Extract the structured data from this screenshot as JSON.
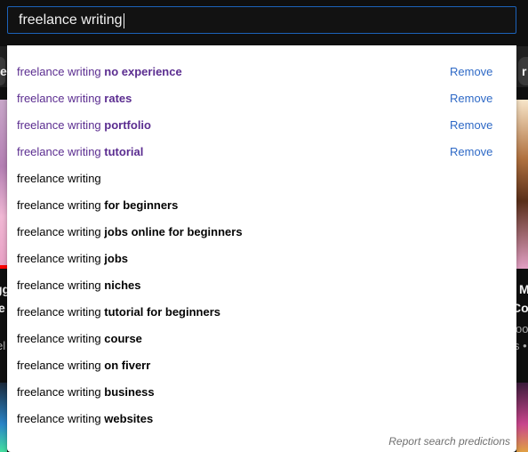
{
  "search": {
    "value": "freelance writing"
  },
  "suggestions": [
    {
      "prefix": "freelance writing ",
      "bold": "no experience",
      "history": true
    },
    {
      "prefix": "freelance writing ",
      "bold": "rates",
      "history": true
    },
    {
      "prefix": "freelance writing ",
      "bold": "portfolio",
      "history": true
    },
    {
      "prefix": "freelance writing ",
      "bold": "tutorial",
      "history": true
    },
    {
      "prefix": "freelance writing",
      "bold": "",
      "history": false
    },
    {
      "prefix": "freelance writing ",
      "bold": "for beginners",
      "history": false
    },
    {
      "prefix": "freelance writing ",
      "bold": "jobs online for beginners",
      "history": false
    },
    {
      "prefix": "freelance writing ",
      "bold": "jobs",
      "history": false
    },
    {
      "prefix": "freelance writing ",
      "bold": "niches",
      "history": false
    },
    {
      "prefix": "freelance writing ",
      "bold": "tutorial for beginners",
      "history": false
    },
    {
      "prefix": "freelance writing ",
      "bold": "course",
      "history": false
    },
    {
      "prefix": "freelance writing ",
      "bold": "on fiverr",
      "history": false
    },
    {
      "prefix": "freelance writing ",
      "bold": "business",
      "history": false
    },
    {
      "prefix": "freelance writing ",
      "bold": "websites",
      "history": false
    }
  ],
  "remove_label": "Remove",
  "report_label": "Report search predictions",
  "background": {
    "chip_left": "e",
    "chip_right": "r S",
    "left_title_1": "gg",
    "left_title_2": "e",
    "left_meta": "el",
    "right_title_1": "M",
    "right_title_2": "Co",
    "right_meta_1": "ook",
    "right_meta_2": "s •"
  },
  "colors": {
    "history_text": "#5b2d90",
    "remove_link": "#2e69c6",
    "focus_border": "#1c62b9"
  }
}
